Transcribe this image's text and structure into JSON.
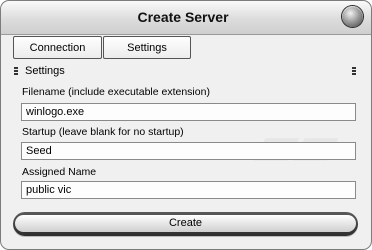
{
  "window": {
    "title": "Create Server"
  },
  "tabs": [
    {
      "label": "Connection"
    },
    {
      "label": "Settings"
    }
  ],
  "settings": {
    "header": "Settings",
    "filename": {
      "label": "Filename (include executable extension)",
      "value": "winlogo.exe"
    },
    "startup": {
      "label": "Startup (leave blank for no startup)",
      "value": "Seed"
    },
    "assigned_name": {
      "label": "Assigned Name",
      "value": "public vic"
    }
  },
  "actions": {
    "create_label": "Create"
  }
}
